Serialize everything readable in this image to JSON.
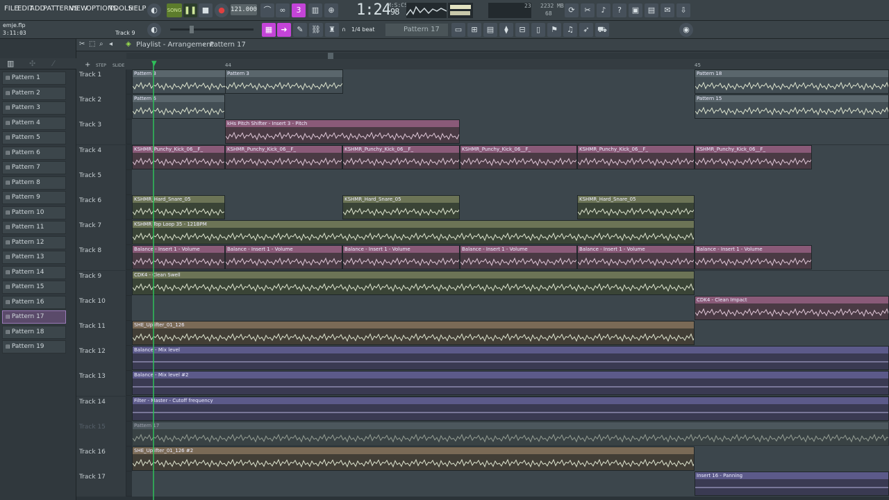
{
  "menu": {
    "items": [
      "FILE",
      "EDIT",
      "ADD",
      "PATTERNS",
      "VIEW",
      "OPTIONS",
      "TOOLS",
      "HELP"
    ]
  },
  "transport": {
    "mode_label": "SONG",
    "tempo": "121.000",
    "time_main": "1:24",
    "time_sub": "98",
    "time_unit": "M:S:CS"
  },
  "cpu": {
    "memory": "2232 MB",
    "polyphony": "68",
    "cpu": "23"
  },
  "project": {
    "filename": "emje.flp",
    "position": "3:11:03",
    "hint": "Track 9"
  },
  "toolbar": {
    "snap": "1/4 beat",
    "pattern": "Pattern 17"
  },
  "playlist": {
    "title": "Playlist - Arrangement",
    "pattern": "Pattern 17"
  },
  "ruler": {
    "markers": [
      "44",
      "45"
    ]
  },
  "browser": {
    "patterns": [
      "Pattern 1",
      "Pattern 2",
      "Pattern 3",
      "Pattern 4",
      "Pattern 5",
      "Pattern 6",
      "Pattern 7",
      "Pattern 8",
      "Pattern 9",
      "Pattern 10",
      "Pattern 11",
      "Pattern 12",
      "Pattern 13",
      "Pattern 14",
      "Pattern 15",
      "Pattern 16",
      "Pattern 17",
      "Pattern 18",
      "Pattern 19"
    ],
    "selected": "Pattern 17"
  },
  "tracks": [
    {
      "name": "Track 1",
      "clips": [
        {
          "label": "Pattern 3",
          "type": "gray"
        },
        {
          "label": "Pattern 3",
          "type": "gray"
        },
        {
          "label": "Pattern 18",
          "type": "gray"
        }
      ]
    },
    {
      "name": "Track 2",
      "clips": [
        {
          "label": "Pattern 6",
          "type": "gray"
        },
        {
          "label": "Pattern 15",
          "type": "gray"
        }
      ]
    },
    {
      "name": "Track 3",
      "clips": [
        {
          "label": "kHs Pitch Shifter - Insert 3 - Pitch",
          "type": "pink"
        }
      ]
    },
    {
      "name": "Track 4",
      "clips": [
        {
          "label": "KSHMR_Punchy_Kick_06__F_",
          "type": "pink"
        }
      ]
    },
    {
      "name": "Track 5",
      "clips": []
    },
    {
      "name": "Track 6",
      "clips": [
        {
          "label": "KSHMR_Hard_Snare_05",
          "type": "olive"
        }
      ]
    },
    {
      "name": "Track 7",
      "clips": [
        {
          "label": "KSHMR Top Loop 35 - 121BPM",
          "type": "olive"
        }
      ]
    },
    {
      "name": "Track 8",
      "clips": [
        {
          "label": "Balance - Insert 1 - Volume",
          "type": "pink"
        }
      ]
    },
    {
      "name": "Track 9",
      "clips": [
        {
          "label": "CDK4 - Clean Swell",
          "type": "olive"
        }
      ]
    },
    {
      "name": "Track 10",
      "clips": [
        {
          "label": "CDK4 - Clean Impact",
          "type": "pink"
        }
      ]
    },
    {
      "name": "Track 11",
      "clips": [
        {
          "label": "SHE_Uplifter_01_126",
          "type": "tan"
        }
      ]
    },
    {
      "name": "Track 12",
      "clips": [
        {
          "label": "Balance - Mix level",
          "type": "purple"
        }
      ]
    },
    {
      "name": "Track 13",
      "clips": [
        {
          "label": "Balance - Mix level #2",
          "type": "purple"
        }
      ]
    },
    {
      "name": "Track 14",
      "clips": [
        {
          "label": "Filter - Master - Cutoff frequency",
          "type": "purple"
        }
      ]
    },
    {
      "name": "Track 15",
      "clips": [
        {
          "label": "Pattern 17",
          "type": "dim"
        }
      ]
    },
    {
      "name": "Track 16",
      "clips": [
        {
          "label": "SHE_Uplifter_01_126 #2",
          "type": "tan"
        }
      ]
    },
    {
      "name": "Track 17",
      "clips": [
        {
          "label": "Insert 16 - Panning",
          "type": "purple"
        }
      ]
    }
  ]
}
